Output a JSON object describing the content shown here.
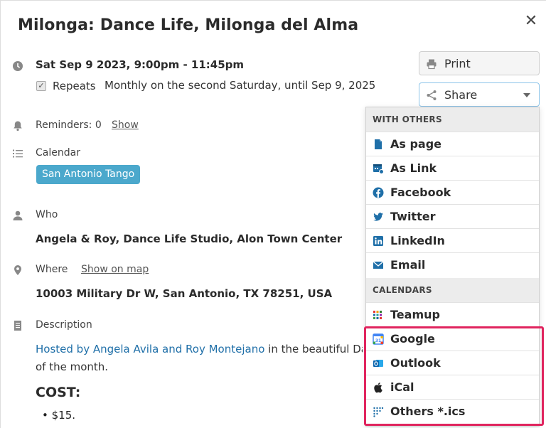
{
  "event": {
    "title": "Milonga: Dance Life, Milonga del Alma",
    "datetime": "Sat Sep 9 2023, 9:00pm - 11:45pm",
    "repeats_label": "Repeats",
    "repeats_value": "Monthly on the second Saturday, until Sep 9, 2025",
    "reminders": "Reminders: 0",
    "reminders_show": "Show",
    "calendar_label": "Calendar",
    "calendar_name": "San Antonio Tango",
    "who_label": "Who",
    "who_value": "Angela & Roy, Dance Life Studio, Alon Town Center",
    "where_label": "Where",
    "where_link": "Show on map",
    "where_value": "10003 Military Dr W, San Antonio, TX 78251, USA",
    "description_label": "Description",
    "description_link": "Hosted by Angela Avila and Roy Montejano",
    "description_text": " in the beautiful Da",
    "description_line2": "of the month.",
    "cost_heading": "COST:",
    "cost_item": "$15."
  },
  "actions": {
    "print": "Print",
    "share": "Share"
  },
  "share_menu": {
    "with_others_header": "WITH OTHERS",
    "with_others": [
      {
        "label": "As page",
        "icon": "page-icon"
      },
      {
        "label": "As Link",
        "icon": "link-icon"
      },
      {
        "label": "Facebook",
        "icon": "facebook-icon"
      },
      {
        "label": "Twitter",
        "icon": "twitter-icon"
      },
      {
        "label": "LinkedIn",
        "icon": "linkedin-icon"
      },
      {
        "label": "Email",
        "icon": "email-icon"
      }
    ],
    "calendars_header": "CALENDARS",
    "calendars": [
      {
        "label": "Teamup",
        "icon": "teamup-icon"
      },
      {
        "label": "Google",
        "icon": "google-calendar-icon"
      },
      {
        "label": "Outlook",
        "icon": "outlook-icon"
      },
      {
        "label": "iCal",
        "icon": "apple-icon"
      },
      {
        "label": "Others *.ics",
        "icon": "ics-icon"
      }
    ]
  },
  "colors": {
    "calendar_badge": "#4ba8cc",
    "link": "#1f6fa8",
    "highlight": "#e0245e"
  }
}
